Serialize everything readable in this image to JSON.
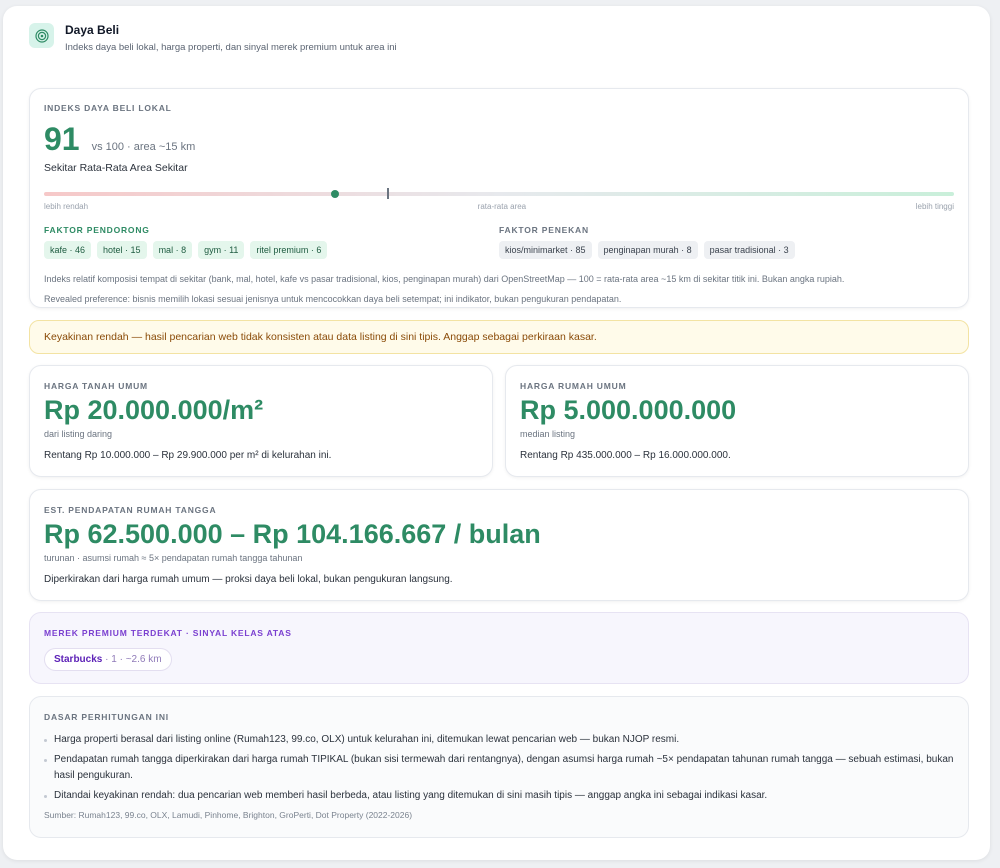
{
  "header": {
    "title": "Daya Beli",
    "subtitle": "Indeks daya beli lokal, harga properti, dan sinyal merek premium untuk area ini",
    "icon": "target-icon"
  },
  "index": {
    "label": "INDEKS DAYA BELI LOKAL",
    "value": "91",
    "comparison": "vs 100 · area ~15 km",
    "level": "Sekitar Rata-Rata Area Sekitar",
    "bar_position": 0.32,
    "bar_low": "lebih rendah",
    "bar_mid": "rata-rata area",
    "bar_high": "lebih tinggi",
    "drivers_label": "FAKTOR PENDORONG",
    "drivers": [
      "kafe · 46",
      "hotel · 15",
      "mal · 8",
      "gym · 11",
      "ritel premium · 6"
    ],
    "suppressors_label": "FAKTOR PENEKAN",
    "suppressors": [
      "kios/minimarket · 85",
      "penginapan murah · 8",
      "pasar tradisional · 3"
    ],
    "note1": "Indeks relatif komposisi tempat di sekitar (bank, mal, hotel, kafe vs pasar tradisional, kios, penginapan murah) dari OpenStreetMap — 100 = rata-rata area ~15 km di sekitar titik ini. Bukan angka rupiah.",
    "note2": "Revealed preference: bisnis memilih lokasi sesuai jenisnya untuk mencocokkan daya beli setempat; ini indikator, bukan pengukuran pendapatan."
  },
  "warning": "Keyakinan rendah — hasil pencarian web tidak konsisten atau data listing di sini tipis. Anggap sebagai perkiraan kasar.",
  "land": {
    "label": "HARGA TANAH UMUM",
    "price": "Rp 20.000.000/m²",
    "source": "dari listing daring",
    "range": "Rentang Rp 10.000.000 – Rp 29.900.000 per m² di kelurahan ini."
  },
  "house": {
    "label": "HARGA RUMAH UMUM",
    "price": "Rp 5.000.000.000",
    "source": "median listing",
    "range": "Rentang Rp 435.000.000 – Rp 16.000.000.000."
  },
  "income": {
    "label": "EST. PENDAPATAN RUMAH TANGGA",
    "value": "Rp 62.500.000 – Rp 104.166.667 / bulan",
    "assumption": "turunan · asumsi rumah ≈ 5× pendapatan rumah tangga tahunan",
    "desc": "Diperkirakan dari harga rumah umum — proksi daya beli lokal, bukan pengukuran langsung."
  },
  "brands": {
    "label": "MEREK PREMIUM TERDEKAT · SINYAL KELAS ATAS",
    "items": [
      {
        "name": "Starbucks",
        "meta": " · 1 · ~2.6 km"
      }
    ]
  },
  "basis": {
    "label": "DASAR PERHITUNGAN INI",
    "items": [
      "Harga properti berasal dari listing online (Rumah123, 99.co, OLX) untuk kelurahan ini, ditemukan lewat pencarian web — bukan NJOP resmi.",
      "Pendapatan rumah tangga diperkirakan dari harga rumah TIPIKAL (bukan sisi termewah dari rentangnya), dengan asumsi harga rumah ~5× pendapatan tahunan rumah tangga — sebuah estimasi, bukan hasil pengukuran.",
      "Ditandai keyakinan rendah: dua pencarian web memberi hasil berbeda, atau listing yang ditemukan di sini masih tipis — anggap angka ini sebagai indikasi kasar."
    ],
    "sources": "Sumber: Rumah123, 99.co, OLX, Lamudi, Pinhome, Brighton, GroPerti, Dot Property (2022-2026)"
  },
  "colors": {
    "accent": "#2e8b64",
    "warning_bg": "#fffbea",
    "brand_purple": "#7a3fd0"
  }
}
